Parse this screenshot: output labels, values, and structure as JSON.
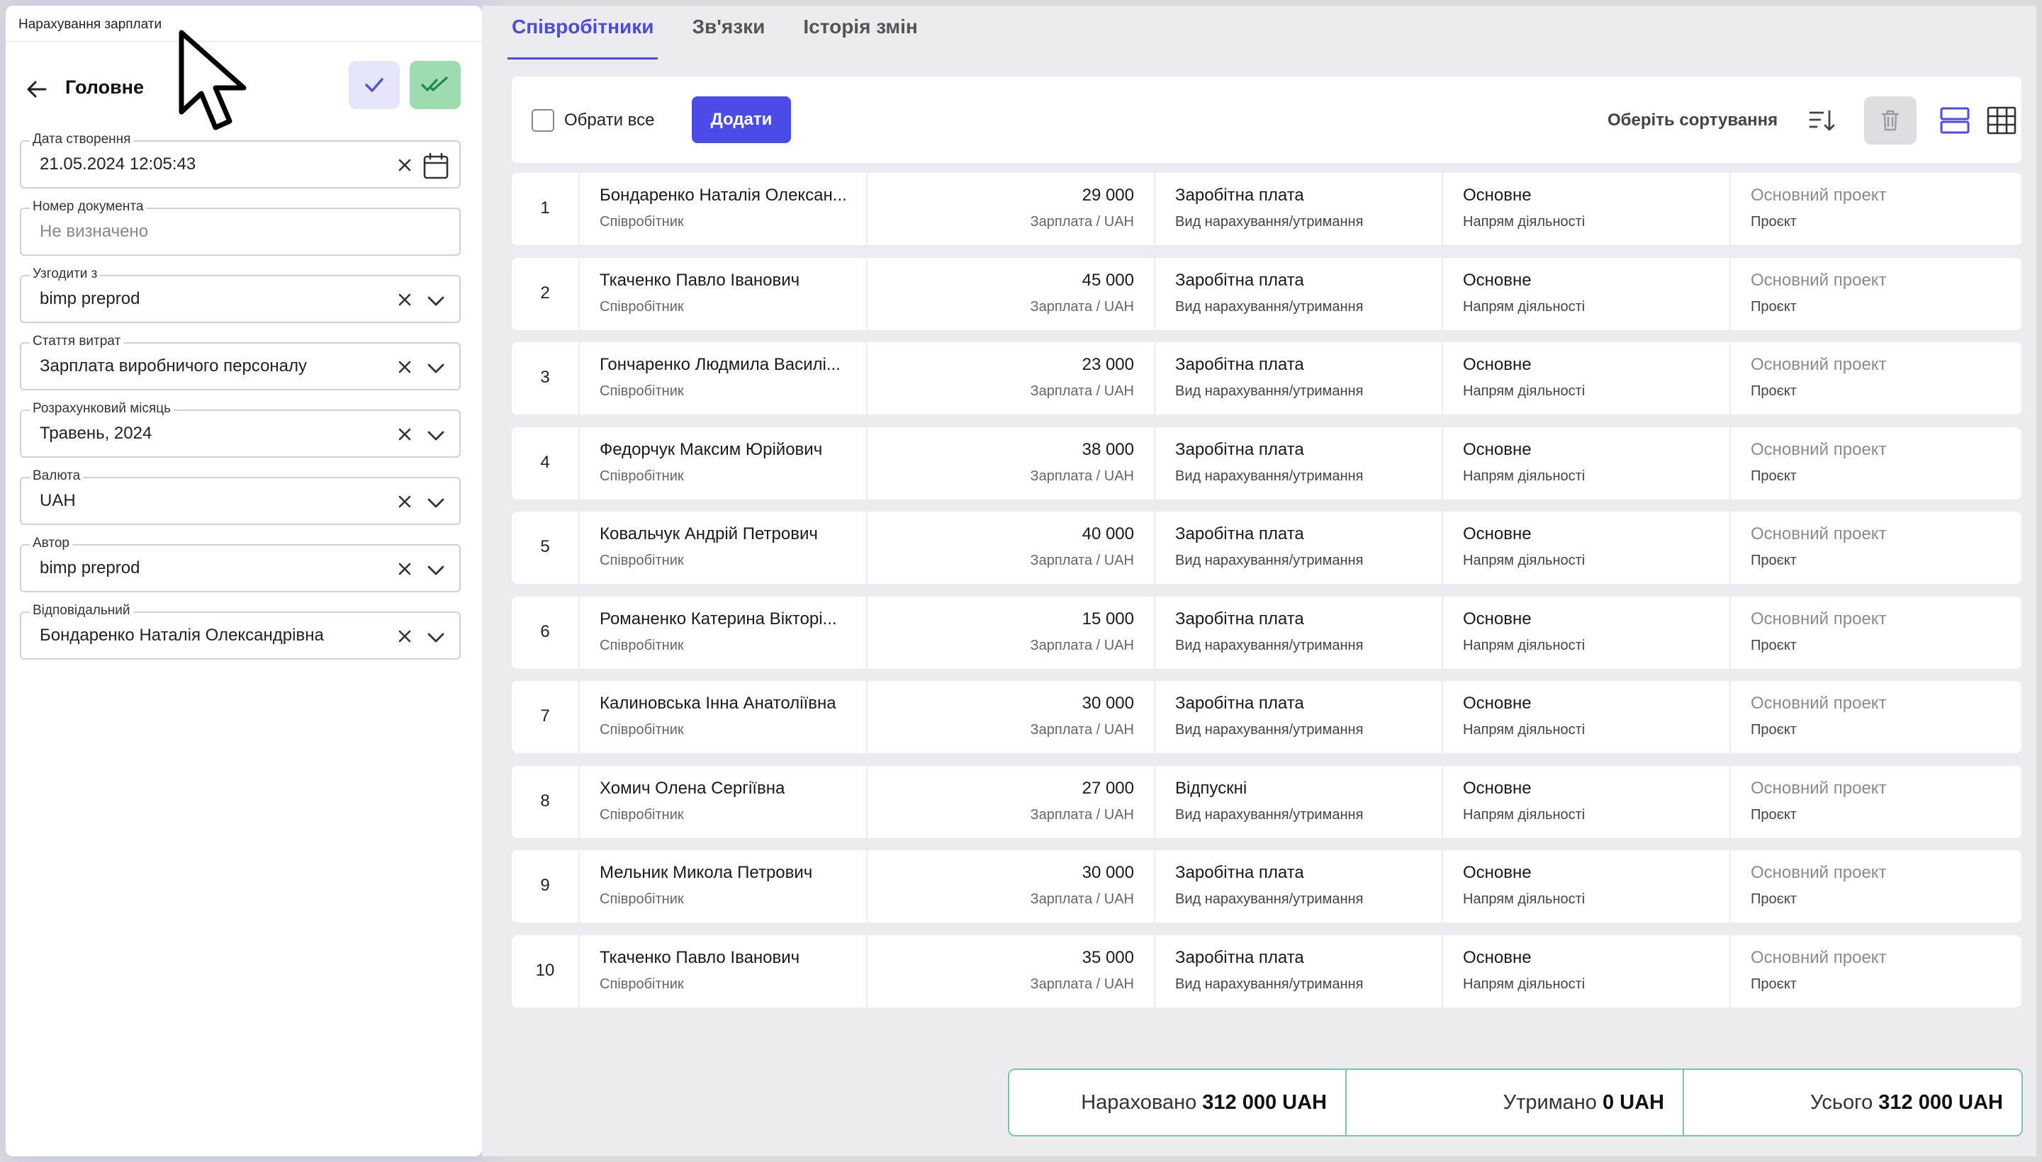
{
  "left_panel": {
    "window_title": "Нарахування зарплати",
    "heading": "Головне",
    "fields": [
      {
        "label": "Дата створення",
        "value": "21.05.2024 12:05:43"
      },
      {
        "label": "Номер документа",
        "placeholder": "Не визначено"
      },
      {
        "label": "Узгодити з",
        "value": "bimp preprod"
      },
      {
        "label": "Стаття витрат",
        "value": "Зарплата виробничого персоналу"
      },
      {
        "label": "Розрахунковий місяць",
        "value": "Травень, 2024"
      },
      {
        "label": "Валюта",
        "value": "UAH"
      },
      {
        "label": "Автор",
        "value": "bimp preprod"
      },
      {
        "label": "Відповідальний",
        "value": "Бондаренко Наталія Олександрівна"
      }
    ]
  },
  "tabs": [
    {
      "label": "Співробітники",
      "active": true
    },
    {
      "label": "Зв'язки",
      "active": false
    },
    {
      "label": "Історія змін",
      "active": false
    }
  ],
  "toolbar": {
    "select_all_label": "Обрати все",
    "add_label": "Додати",
    "sort_label": "Оберіть сортування"
  },
  "rows": [
    {
      "num": "1",
      "name": "Бондаренко Наталія Олексан...",
      "name_sub": "Співробітник",
      "amount": "29 000",
      "amount_sub": "Зарплата / UAH",
      "kind": "Заробітна плата",
      "kind_sub": "Вид нарахування/утримання",
      "direction": "Основне",
      "direction_sub": "Напрям діяльності",
      "project": "Основний проект",
      "project_sub": "Проєкт"
    },
    {
      "num": "2",
      "name": "Ткаченко Павло Іванович",
      "name_sub": "Співробітник",
      "amount": "45 000",
      "amount_sub": "Зарплата / UAH",
      "kind": "Заробітна плата",
      "kind_sub": "Вид нарахування/утримання",
      "direction": "Основне",
      "direction_sub": "Напрям діяльності",
      "project": "Основний проект",
      "project_sub": "Проєкт"
    },
    {
      "num": "3",
      "name": "Гончаренко Людмила Василі...",
      "name_sub": "Співробітник",
      "amount": "23 000",
      "amount_sub": "Зарплата / UAH",
      "kind": "Заробітна плата",
      "kind_sub": "Вид нарахування/утримання",
      "direction": "Основне",
      "direction_sub": "Напрям діяльності",
      "project": "Основний проект",
      "project_sub": "Проєкт"
    },
    {
      "num": "4",
      "name": "Федорчук Максим Юрійович",
      "name_sub": "Співробітник",
      "amount": "38 000",
      "amount_sub": "Зарплата / UAH",
      "kind": "Заробітна плата",
      "kind_sub": "Вид нарахування/утримання",
      "direction": "Основне",
      "direction_sub": "Напрям діяльності",
      "project": "Основний проект",
      "project_sub": "Проєкт"
    },
    {
      "num": "5",
      "name": "Ковальчук Андрій Петрович",
      "name_sub": "Співробітник",
      "amount": "40 000",
      "amount_sub": "Зарплата / UAH",
      "kind": "Заробітна плата",
      "kind_sub": "Вид нарахування/утримання",
      "direction": "Основне",
      "direction_sub": "Напрям діяльності",
      "project": "Основний проект",
      "project_sub": "Проєкт"
    },
    {
      "num": "6",
      "name": "Романенко Катерина Вікторі...",
      "name_sub": "Співробітник",
      "amount": "15 000",
      "amount_sub": "Зарплата / UAH",
      "kind": "Заробітна плата",
      "kind_sub": "Вид нарахування/утримання",
      "direction": "Основне",
      "direction_sub": "Напрям діяльності",
      "project": "Основний проект",
      "project_sub": "Проєкт"
    },
    {
      "num": "7",
      "name": "Калиновська Інна Анатоліївна",
      "name_sub": "Співробітник",
      "amount": "30 000",
      "amount_sub": "Зарплата / UAH",
      "kind": "Заробітна плата",
      "kind_sub": "Вид нарахування/утримання",
      "direction": "Основне",
      "direction_sub": "Напрям діяльності",
      "project": "Основний проект",
      "project_sub": "Проєкт"
    },
    {
      "num": "8",
      "name": "Хомич Олена Сергіївна",
      "name_sub": "Співробітник",
      "amount": "27 000",
      "amount_sub": "Зарплата / UAH",
      "kind": "Відпускні",
      "kind_sub": "Вид нарахування/утримання",
      "direction": "Основне",
      "direction_sub": "Напрям діяльності",
      "project": "Основний проект",
      "project_sub": "Проєкт"
    },
    {
      "num": "9",
      "name": "Мельник Микола Петрович",
      "name_sub": "Співробітник",
      "amount": "30 000",
      "amount_sub": "Зарплата / UAH",
      "kind": "Заробітна плата",
      "kind_sub": "Вид нарахування/утримання",
      "direction": "Основне",
      "direction_sub": "Напрям діяльності",
      "project": "Основний проект",
      "project_sub": "Проєкт"
    },
    {
      "num": "10",
      "name": "Ткаченко Павло Іванович",
      "name_sub": "Співробітник",
      "amount": "35 000",
      "amount_sub": "Зарплата / UAH",
      "kind": "Заробітна плата",
      "kind_sub": "Вид нарахування/утримання",
      "direction": "Основне",
      "direction_sub": "Напрям діяльності",
      "project": "Основний проект",
      "project_sub": "Проєкт"
    }
  ],
  "totals": {
    "accrued_label": "Нараховано",
    "accrued_value": "312 000 UAH",
    "withheld_label": "Утримано",
    "withheld_value": "0 UAH",
    "total_label": "Усього",
    "total_value": "312 000 UAH"
  },
  "colors": {
    "accent": "#4b4be8",
    "confirm_green": "#9ddbb0",
    "totals_border": "#7dc89a"
  },
  "icons": [
    "back-arrow-icon",
    "check-icon",
    "double-check-icon",
    "clear-icon",
    "chevron-down-icon",
    "calendar-icon",
    "sort-icon",
    "trash-icon",
    "list-view-icon",
    "grid-view-icon",
    "mouse-cursor-icon"
  ]
}
